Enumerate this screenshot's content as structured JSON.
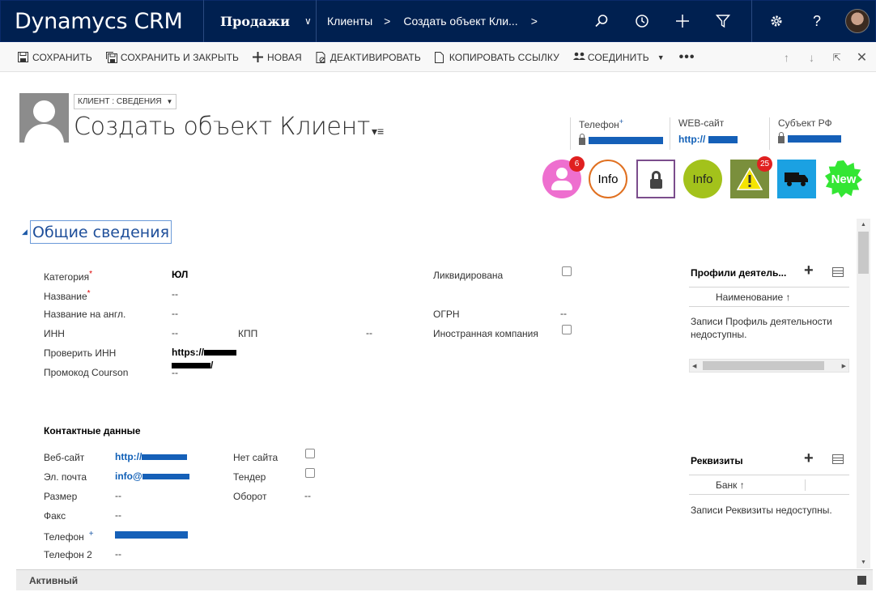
{
  "app": {
    "brand": "Dynamycs CRM",
    "area": "Продажи"
  },
  "breadcrumb": {
    "entity": "Клиенты",
    "record": "Создать объект Кли..."
  },
  "toolbar": {
    "save": "СОХРАНИТЬ",
    "save_close": "СОХРАНИТЬ И ЗАКРЫТЬ",
    "new": "НОВАЯ",
    "deactivate": "ДЕАКТИВИРОВАТЬ",
    "copy_link": "КОПИРОВАТЬ ССЫЛКУ",
    "connect": "СОЕДИНИТЬ"
  },
  "header": {
    "form_selector": "КЛИЕНТ : СВЕДЕНИЯ",
    "title": "Создать объект Клиент",
    "fields": [
      {
        "label": "Телефон",
        "required_mark": "+"
      },
      {
        "label": "WEB-сайт",
        "value": "http://"
      },
      {
        "label": "Субъект РФ"
      }
    ]
  },
  "badges": [
    {
      "kind": "person",
      "color": "#ee6fcf",
      "counter": "6"
    },
    {
      "kind": "info-outline",
      "label": "Info",
      "color": "#e07020"
    },
    {
      "kind": "lock",
      "color": "#7b4d8c"
    },
    {
      "kind": "info-filled",
      "label": "Info",
      "color": "#a3c21b"
    },
    {
      "kind": "warning",
      "color": "#7a8f3c",
      "counter": "25"
    },
    {
      "kind": "truck",
      "color": "#1ba1e2"
    },
    {
      "kind": "new",
      "label": "New",
      "color": "#33e633"
    }
  ],
  "section": {
    "title": "Общие сведения",
    "fields": {
      "category": {
        "label": "Категория",
        "required": "*",
        "value": "ЮЛ"
      },
      "name": {
        "label": "Название",
        "required": "*",
        "value": "--"
      },
      "name_en": {
        "label": "Название на англ.",
        "value": "--"
      },
      "inn": {
        "label": "ИНН",
        "value": "--"
      },
      "kpp": {
        "label": "КПП",
        "value": "--"
      },
      "check_inn": {
        "label": "Проверить ИНН",
        "value_line1": "https://",
        "value_line2": "/"
      },
      "promo": {
        "label": "Промокод Courson",
        "value": "--"
      },
      "liquidated": {
        "label": "Ликвидирована"
      },
      "ogrn": {
        "label": "ОГРН",
        "value": "--"
      },
      "foreign": {
        "label": "Иностранная компания"
      }
    },
    "contacts": {
      "title": "Контактные данные",
      "website": {
        "label": "Веб-сайт",
        "value": "http://"
      },
      "email": {
        "label": "Эл. почта",
        "value": "info@"
      },
      "size": {
        "label": "Размер",
        "value": "--"
      },
      "fax": {
        "label": "Факс",
        "value": "--"
      },
      "phone": {
        "label": "Телефон",
        "required_mark": "+"
      },
      "phone2": {
        "label": "Телефон 2",
        "value": "--"
      },
      "no_site": {
        "label": "Нет сайта"
      },
      "tender": {
        "label": "Тендер"
      },
      "turnover": {
        "label": "Оборот",
        "value": "--"
      }
    }
  },
  "subgrids": {
    "profiles": {
      "title": "Профили деятель...",
      "column": "Наименование ↑",
      "empty": "Записи Профиль деятельности недоступны."
    },
    "requisites": {
      "title": "Реквизиты",
      "column": "Банк ↑",
      "empty": "Записи Реквизиты недоступны."
    }
  },
  "footer": {
    "status": "Активный"
  }
}
